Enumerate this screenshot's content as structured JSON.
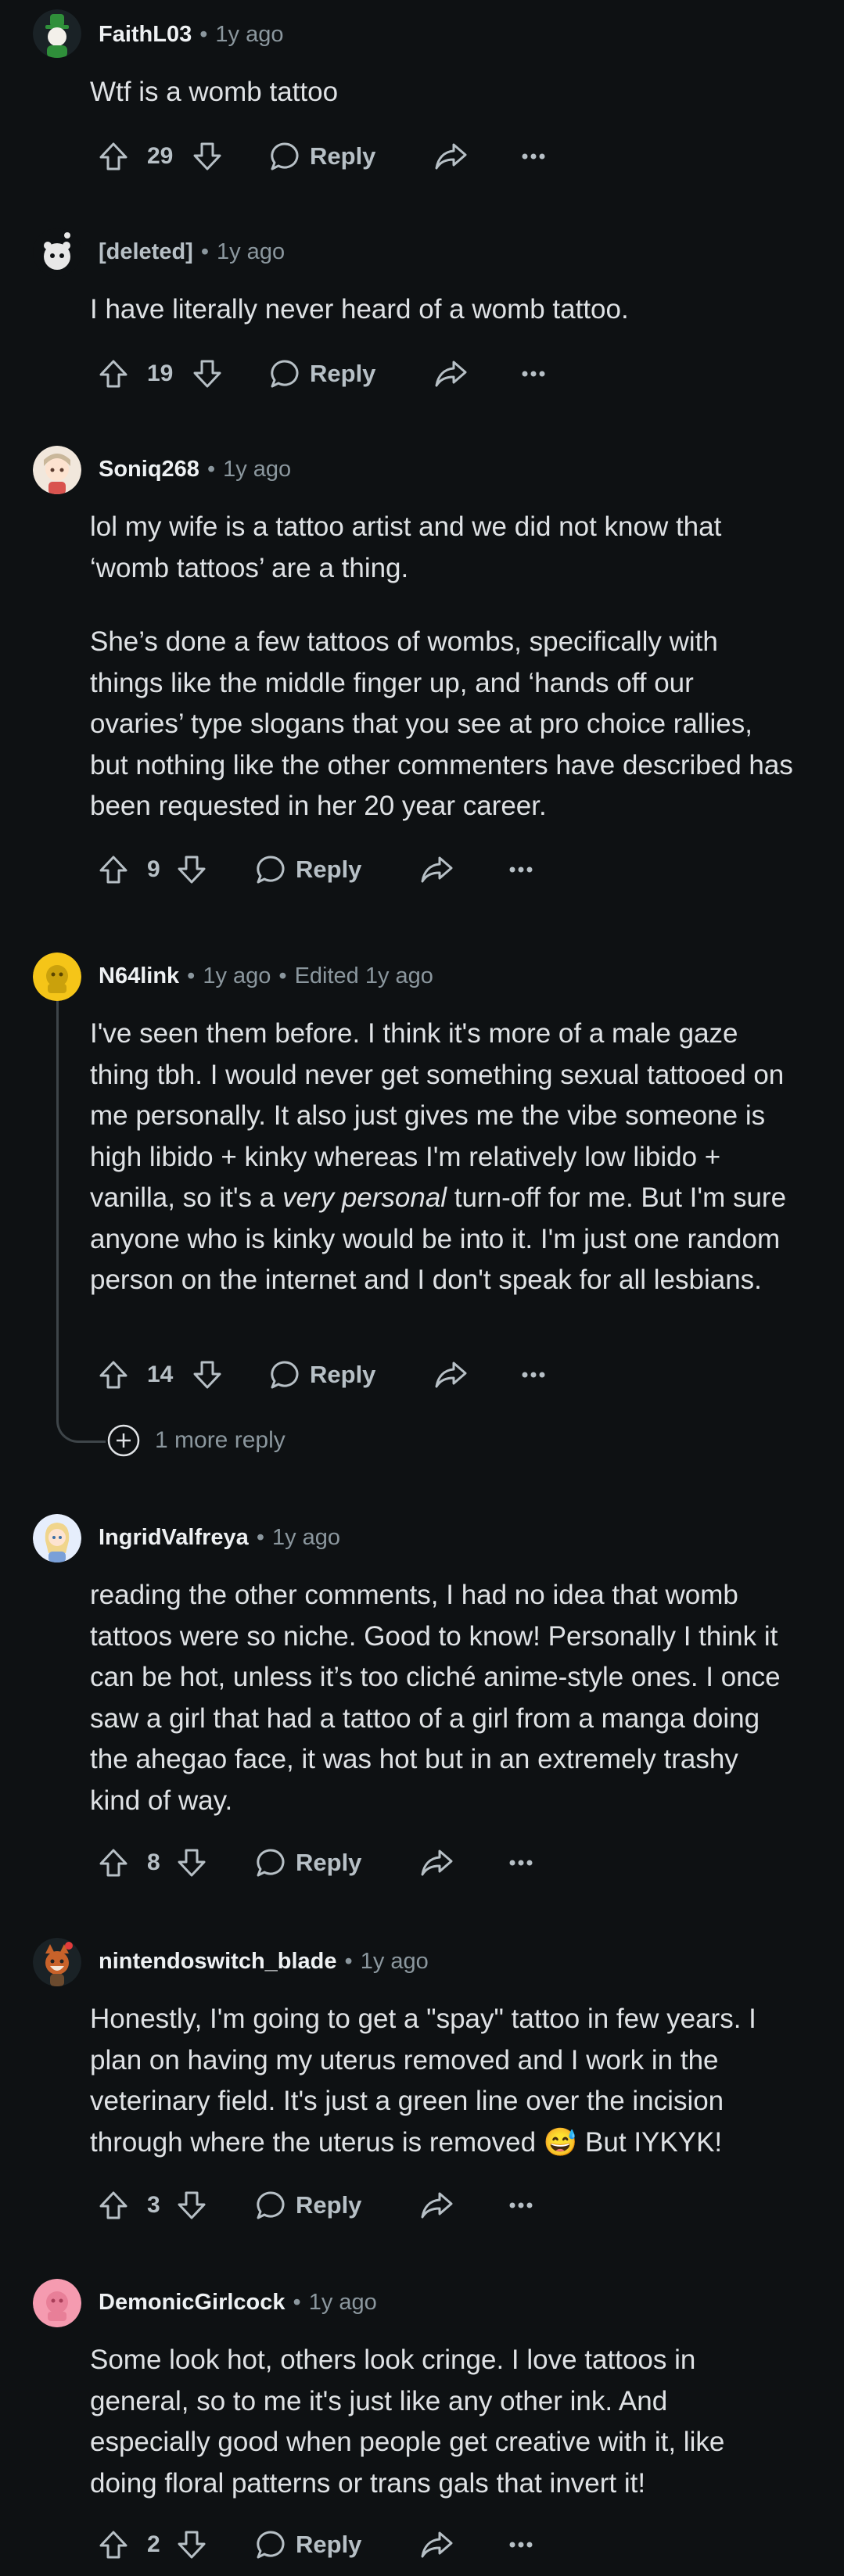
{
  "labels": {
    "reply": "Reply",
    "more_replies": "1 more reply",
    "edited_sep": "•",
    "dot": "•"
  },
  "comments": [
    {
      "author": "FaithL03",
      "time": "1y ago",
      "edited": "",
      "score": "29",
      "avatar": "green-hat-avatar",
      "paragraphs": [
        "Wtf is a womb tattoo"
      ]
    },
    {
      "author": "[deleted]",
      "time": "1y ago",
      "edited": "",
      "score": "19",
      "avatar": "deleted-user-avatar",
      "paragraphs": [
        "I have literally never heard of a womb tattoo."
      ]
    },
    {
      "author": "Soniq268",
      "time": "1y ago",
      "edited": "",
      "score": "9",
      "avatar": "anime-girl-avatar",
      "paragraphs": [
        "lol my wife is a tattoo artist and we did not know that ‘womb tattoos’ are a thing.",
        "She’s done a few tattoos of wombs, specifically with things like the middle finger up, and ‘hands off our ovaries’ type slogans that you see at pro choice rallies, but nothing like the other commenters have described has been requested in her 20 year career."
      ]
    },
    {
      "author": "N64link",
      "time": "1y ago",
      "edited": "Edited 1y ago",
      "score": "14",
      "avatar": "yellow-avatar",
      "paragraphs": [
        "I've seen them before. I think it's more of a male gaze thing tbh. I would never get something sexual tattooed on me personally. It also just gives me the vibe someone is high libido + kinky whereas I'm relatively low libido + vanilla, so it's a ",
        "very personal",
        " turn-off for me. But I'm sure anyone who is kinky would be into it. I'm just one random person on the internet and I don't speak for all lesbians."
      ]
    },
    {
      "author": "IngridValfreya",
      "time": "1y ago",
      "edited": "",
      "score": "8",
      "avatar": "blonde-girl-avatar",
      "paragraphs": [
        "reading the other comments, I had no idea that womb tattoos were so niche. Good to know! Personally I think it can be hot, unless it’s too cliché anime-style ones. I once saw a girl that had a tattoo of a girl from a manga doing the ahegao face, it was hot but in an extremely trashy kind of way."
      ]
    },
    {
      "author": "nintendoswitch_blade",
      "time": "1y ago",
      "edited": "",
      "score": "3",
      "avatar": "fox-avatar",
      "paragraphs": [
        "Honestly, I'm going to get a \"spay\" tattoo in few years. I plan on having my uterus removed and I work in the veterinary field. It's just a green line over the incision through where the uterus is removed 😅 But IYKYK!"
      ]
    },
    {
      "author": "DemonicGirlcock",
      "time": "1y ago",
      "edited": "",
      "score": "2",
      "avatar": "pink-avatar",
      "paragraphs": [
        "Some look hot, others look cringe. I love tattoos in general, so to me it's just like any other ink. And especially good when people get creative with it, like doing floral patterns or trans gals that invert it!"
      ]
    }
  ]
}
